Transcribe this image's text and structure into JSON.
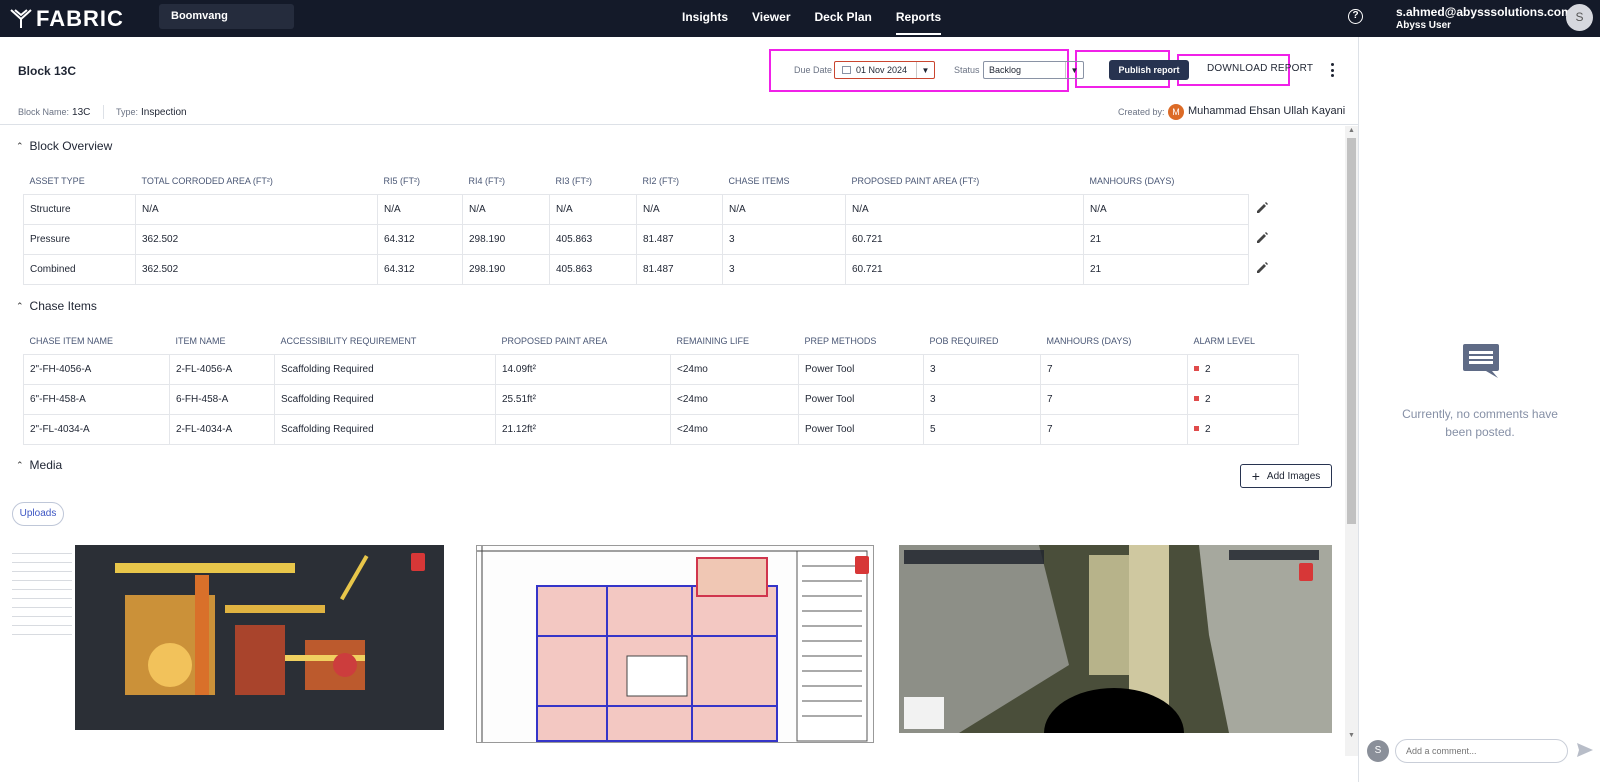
{
  "topbar": {
    "logo_text": "FABRIC",
    "project": "Boomvang",
    "nav": [
      {
        "label": "Insights",
        "active": false
      },
      {
        "label": "Viewer",
        "active": false
      },
      {
        "label": "Deck Plan",
        "active": false
      },
      {
        "label": "Reports",
        "active": true
      }
    ],
    "user_email": "s.ahmed@abysssolutions.com.au",
    "user_role": "Abyss User",
    "avatar_initial": "S"
  },
  "header": {
    "title": "Block 13C",
    "due_date_label": "Due Date",
    "due_date_value": "01 Nov 2024",
    "status_label": "Status",
    "status_value": "Backlog",
    "publish_label": "Publish report",
    "download_label": "DOWNLOAD REPORT",
    "block_name_label": "Block Name:",
    "block_name_value": "13C",
    "type_label": "Type:",
    "type_value": "Inspection",
    "created_by_label": "Created by:",
    "creator_initial": "M",
    "creator_name": "Muhammad Ehsan Ullah Kayani"
  },
  "block_overview": {
    "title": "Block Overview",
    "columns": [
      "ASSET TYPE",
      "TOTAL CORRODED AREA (FT²)",
      "RI5 (FT²)",
      "RI4 (FT²)",
      "RI3 (FT²)",
      "RI2 (FT²)",
      "CHASE ITEMS",
      "PROPOSED PAINT AREA (FT²)",
      "MANHOURS (DAYS)"
    ],
    "rows": [
      [
        "Structure",
        "N/A",
        "N/A",
        "N/A",
        "N/A",
        "N/A",
        "N/A",
        "N/A",
        "N/A"
      ],
      [
        "Pressure",
        "362.502",
        "64.312",
        "298.190",
        "405.863",
        "81.487",
        "3",
        "60.721",
        "21"
      ],
      [
        "Combined",
        "362.502",
        "64.312",
        "298.190",
        "405.863",
        "81.487",
        "3",
        "60.721",
        "21"
      ]
    ]
  },
  "chase_items": {
    "title": "Chase Items",
    "columns": [
      "CHASE ITEM NAME",
      "ITEM NAME",
      "ACCESSIBILITY REQUIREMENT",
      "PROPOSED PAINT AREA",
      "REMAINING LIFE",
      "PREP METHODS",
      "POB REQUIRED",
      "MANHOURS (DAYS)",
      "ALARM LEVEL"
    ],
    "rows": [
      [
        "2\"-FH-4056-A",
        "2-FL-4056-A",
        "Scaffolding Required",
        "14.09ft²",
        "<24mo",
        "Power Tool",
        "3",
        "7",
        "2"
      ],
      [
        "6\"-FH-458-A",
        "6-FH-458-A",
        "Scaffolding Required",
        "25.51ft²",
        "<24mo",
        "Power Tool",
        "3",
        "7",
        "2"
      ],
      [
        "2\"-FL-4034-A",
        "2-FL-4034-A",
        "Scaffolding Required",
        "21.12ft²",
        "<24mo",
        "Power Tool",
        "5",
        "7",
        "2"
      ]
    ],
    "alarm_color": "#e04b4b"
  },
  "media": {
    "title": "Media",
    "add_images_label": "Add Images",
    "tab_label": "Uploads"
  },
  "comments": {
    "empty_text": "Currently, no comments have been posted.",
    "avatar_initial": "S",
    "input_placeholder": "Add a comment..."
  },
  "colors": {
    "topbar_bg": "#141a29",
    "accent": "#273350",
    "highlight": "#f021e8"
  }
}
